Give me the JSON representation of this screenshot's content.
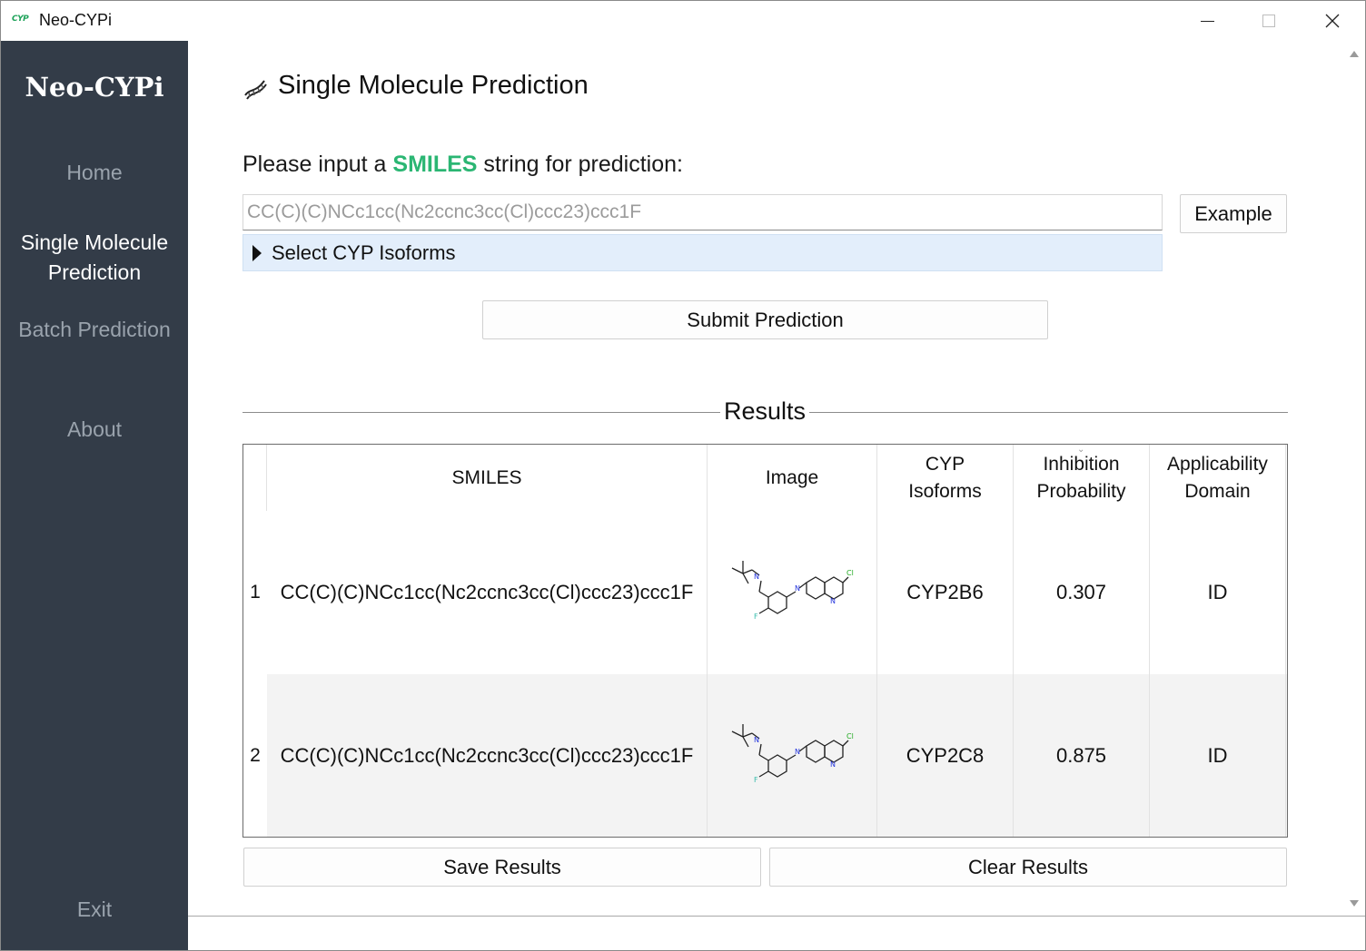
{
  "window": {
    "logo_text": "CYP",
    "title": "Neo-CYPi"
  },
  "sidebar": {
    "title": "Neo-CYPi",
    "items": [
      {
        "label": "Home"
      },
      {
        "label": "Single Molecule Prediction"
      },
      {
        "label": "Batch Prediction"
      },
      {
        "label": "About"
      },
      {
        "label": "Exit"
      }
    ],
    "bg_color": "#333c48"
  },
  "main": {
    "title": "Single Molecule Prediction",
    "prompt_prefix": "Please input a ",
    "prompt_highlight": "SMILES",
    "prompt_suffix": " string for prediction:",
    "highlight_color": "#2bb673",
    "smiles_input": {
      "placeholder": "CC(C)(C)NCc1cc(Nc2ccnc3cc(Cl)ccc23)ccc1F",
      "value": ""
    },
    "example_button": "Example",
    "isoforms_label": "Select CYP Isoforms",
    "submit_button": "Submit Prediction",
    "results_label": "Results",
    "table": {
      "headers": {
        "smiles": "SMILES",
        "image": "Image",
        "cyp_line1": "CYP",
        "cyp_line2": "Isoforms",
        "prob_line1": "Inhibition",
        "prob_line2": "Probability",
        "ad_line1": "Applicability",
        "ad_line2": "Domain"
      },
      "rows": [
        {
          "num": "1",
          "smiles": "CC(C)(C)NCc1cc(Nc2ccnc3cc(Cl)ccc23)ccc1F",
          "isoform": "CYP2B6",
          "probability": "0.307",
          "domain": "ID"
        },
        {
          "num": "2",
          "smiles": "CC(C)(C)NCc1cc(Nc2ccnc3cc(Cl)ccc23)ccc1F",
          "isoform": "CYP2C8",
          "probability": "0.875",
          "domain": "ID"
        }
      ]
    },
    "save_button": "Save Results",
    "clear_button": "Clear Results"
  }
}
